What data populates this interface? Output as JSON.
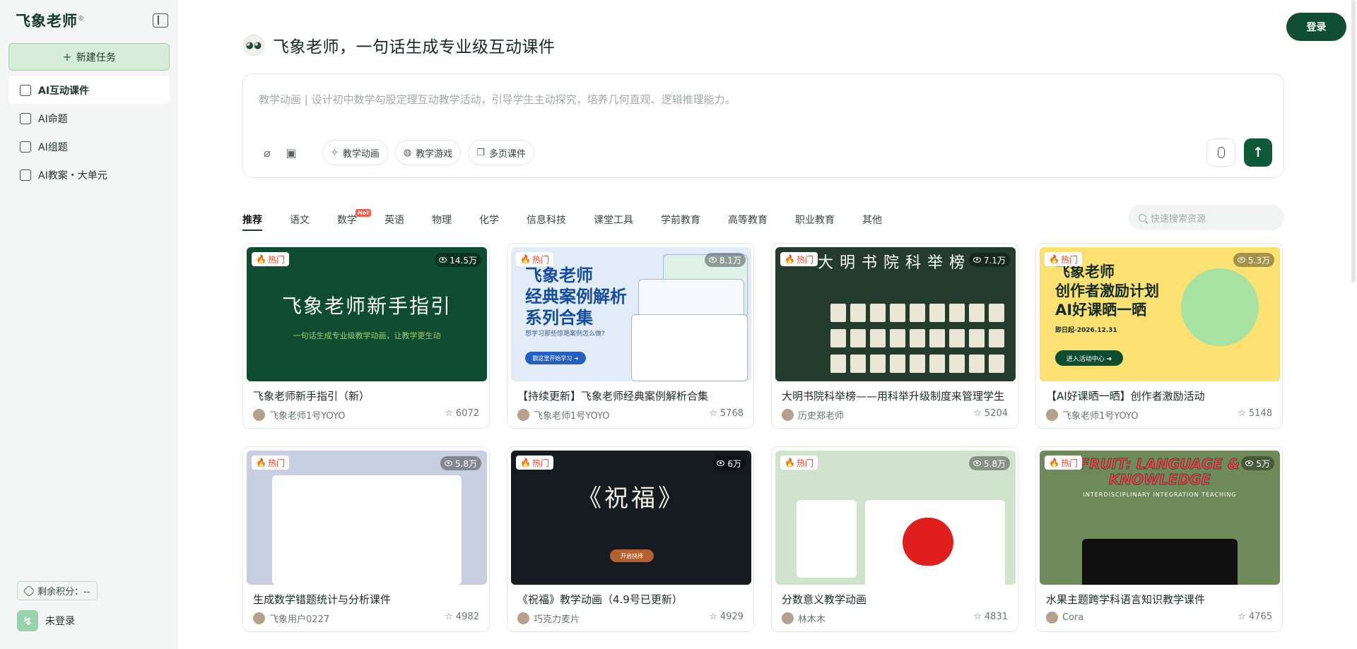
{
  "sidebar": {
    "logo": "飞象老师",
    "logo_mark": "®",
    "new_task": "新建任务",
    "items": [
      {
        "label": "AI互动课件",
        "active": true
      },
      {
        "label": "AI命题"
      },
      {
        "label": "AI组题"
      },
      {
        "label": "AI教案・大单元"
      }
    ],
    "points_label": "剩余积分：--",
    "user_status": "未登录"
  },
  "header": {
    "login": "登录",
    "title": "飞象老师，一句话生成专业级互动课件"
  },
  "prompt": {
    "placeholder": "教学动画 | 设计初中数学勾股定理互动教学活动，引导学生主动探究，培养几何直观、逻辑推理能力。",
    "chips": [
      "教学动画",
      "教学游戏",
      "多页课件"
    ]
  },
  "tabs": [
    "推荐",
    "语文",
    "数学",
    "英语",
    "物理",
    "化学",
    "信息科技",
    "课堂工具",
    "学前教育",
    "高等教育",
    "职业教育",
    "其他"
  ],
  "tab_badge": "Hot",
  "search_placeholder": "快速搜索资源",
  "hot_label": "热门",
  "cards": [
    {
      "views": "14.5万",
      "title": "飞象老师新手指引（新）",
      "author": "飞象老师1号YOYO",
      "stars": "6072",
      "thumb_title": "飞象老师新手指引",
      "thumb_sub": "一句话生成专业级教学动画，让教学更生动"
    },
    {
      "views": "8.1万",
      "title": "【持续更新】飞象老师经典案例解析合集",
      "author": "飞象老师1号YOYO",
      "stars": "5768",
      "thumb_title_1": "飞象老师",
      "thumb_title_2": "经典案例解析",
      "thumb_title_3": "系列合集",
      "thumb_sub": "想学习那些惊艳案例怎么做?",
      "thumb_btn": "戳这里开始学习 ➜"
    },
    {
      "views": "7.1万",
      "title": "大明书院科举榜——用科举升级制度来管理学生",
      "author": "历史郑老师",
      "stars": "5204",
      "thumb_title": "大明书院科举榜"
    },
    {
      "views": "5.3万",
      "title": "【AI好课晒一晒】创作者激励活动",
      "author": "飞象老师1号YOYO",
      "stars": "5148",
      "thumb_title_1": "飞象老师",
      "thumb_title_2": "创作者激励计划",
      "thumb_title_3": "AI好课晒一晒",
      "thumb_date": "即日起-2026.12.31",
      "thumb_btn": "进入活动中心 ➜"
    },
    {
      "views": "5.8万",
      "title": "生成数学错题统计与分析课件",
      "author": "飞象用户0227",
      "stars": "4982"
    },
    {
      "views": "6万",
      "title": "《祝福》教学动画（4.9号已更新）",
      "author": "巧克力麦片",
      "stars": "4929",
      "thumb_title": "《祝福》",
      "thumb_btn": "开启抉择"
    },
    {
      "views": "5.8万",
      "title": "分数意义教学动画",
      "author": "林木木",
      "stars": "4831"
    },
    {
      "views": "5万",
      "title": "水果主题跨学科语言知识教学课件",
      "author": "Cora",
      "stars": "4765",
      "thumb_title_1": "FRUIT: LANGUAGE &",
      "thumb_title_2": "KNOWLEDGE",
      "thumb_sub": "INTERDISCIPLINARY INTEGRATION TEACHING"
    }
  ]
}
